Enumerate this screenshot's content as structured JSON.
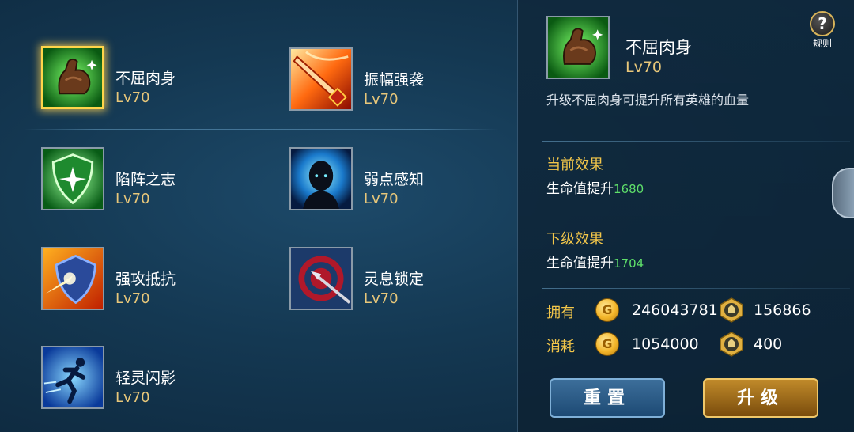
{
  "skills": [
    {
      "name": "不屈肉身",
      "level": "Lv70",
      "icon": "flexed-arm-icon",
      "selected": true
    },
    {
      "name": "振幅强袭",
      "level": "Lv70",
      "icon": "flaming-sword-icon"
    },
    {
      "name": "陷阵之志",
      "level": "Lv70",
      "icon": "green-shield-icon"
    },
    {
      "name": "弱点感知",
      "level": "Lv70",
      "icon": "glowing-head-icon"
    },
    {
      "name": "强攻抵抗",
      "level": "Lv70",
      "icon": "burning-shield-icon"
    },
    {
      "name": "灵息锁定",
      "level": "Lv70",
      "icon": "arrow-target-icon"
    },
    {
      "name": "轻灵闪影",
      "level": "Lv70",
      "icon": "running-figure-icon"
    }
  ],
  "detail": {
    "name": "不屈肉身",
    "level": "Lv70",
    "description": "升级不屈肉身可提升所有英雄的血量",
    "current_title": "当前效果",
    "current_text": "生命值提升",
    "current_value": "1680",
    "next_title": "下级效果",
    "next_text": "生命值提升",
    "next_value": "1704"
  },
  "resources": {
    "own_label": "拥有",
    "own_gold": "246043781",
    "own_medal": "156866",
    "cost_label": "消耗",
    "cost_gold": "1054000",
    "cost_medal": "400",
    "coin_glyph": "G"
  },
  "buttons": {
    "reset": "重置",
    "upgrade": "升级"
  },
  "help": {
    "label": "规则",
    "glyph": "?"
  },
  "colors": {
    "accent_gold": "#f2c64a",
    "value_green": "#5fe06a",
    "selected_border": "#ffd54a"
  }
}
